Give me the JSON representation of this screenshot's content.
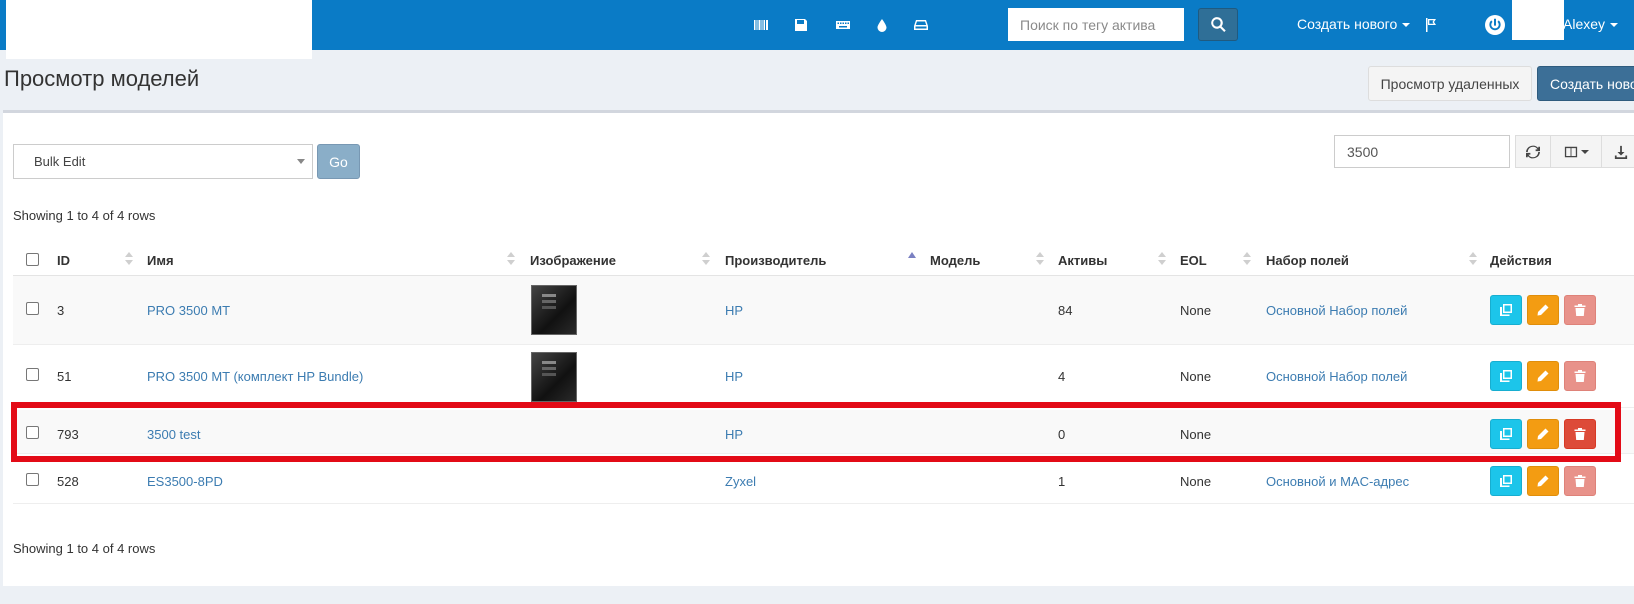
{
  "header": {
    "search_placeholder": "Поиск по тегу актива",
    "create_new_label": "Создать нового",
    "username": "Alexey",
    "nav_icons": [
      "barcode-icon",
      "save-icon",
      "keyboard-icon",
      "tint-icon",
      "hdd-icon"
    ]
  },
  "page": {
    "title": "Просмотр моделей",
    "view_deleted_label": "Просмотр удаленных",
    "create_new_label": "Создать нового"
  },
  "toolbar": {
    "bulk_edit_value": "Bulk Edit",
    "go_label": "Go",
    "search_value": "3500"
  },
  "showing_text": "Showing 1 to 4 of 4 rows",
  "table": {
    "columns": [
      "ID",
      "Имя",
      "Изображение",
      "Производитель",
      "Модель",
      "Активы",
      "EOL",
      "Набор полей",
      "Действия"
    ],
    "sorted_column": "Производитель",
    "rows": [
      {
        "id": "3",
        "name": "PRO 3500 MT",
        "has_image": true,
        "manufacturer": "HP",
        "model": "",
        "assets": "84",
        "eol": "None",
        "fieldset": "Основной Набор полей"
      },
      {
        "id": "51",
        "name": "PRO 3500 MT (комплект HP Bundle)",
        "has_image": true,
        "manufacturer": "HP",
        "model": "",
        "assets": "4",
        "eol": "None",
        "fieldset": "Основной Набор полей"
      },
      {
        "id": "793",
        "name": "3500 test",
        "has_image": false,
        "manufacturer": "HP",
        "model": "",
        "assets": "0",
        "eol": "None",
        "fieldset": "",
        "highlighted": true
      },
      {
        "id": "528",
        "name": "ES3500-8PD",
        "has_image": false,
        "manufacturer": "Zyxel",
        "model": "",
        "assets": "1",
        "eol": "None",
        "fieldset": "Основной и MAC-адрес"
      }
    ]
  },
  "colors": {
    "navbar": "#0a7bc6",
    "link": "#3c7cb1",
    "clone_button": "#1cc5ea",
    "edit_button": "#f39c12",
    "delete_button_disabled": "#e8928a",
    "delete_button_active": "#dd4b39",
    "highlight_border": "#e30b17"
  }
}
